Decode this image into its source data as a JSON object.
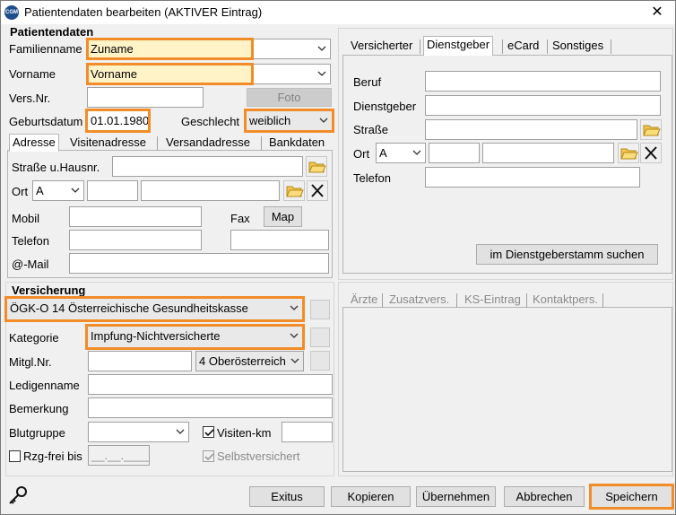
{
  "window": {
    "title": "Patientendaten bearbeiten (AKTIVER Eintrag)",
    "icon_text": "CGM"
  },
  "patient": {
    "section_title": "Patientendaten",
    "familienname_label": "Familienname",
    "familienname_value": "Zuname",
    "vorname_label": "Vorname",
    "vorname_value": "Vorname",
    "versnr_label": "Vers.Nr.",
    "versnr_value": "",
    "foto_label": "Foto",
    "geburtsdatum_label": "Geburtsdatum",
    "geburtsdatum_value": "01.01.1980",
    "geschlecht_label": "Geschlecht",
    "geschlecht_value": "weiblich"
  },
  "address_tabs": [
    "Adresse",
    "Visitenadresse",
    "Versandadresse",
    "Bankdaten"
  ],
  "address": {
    "strasse_label": "Straße u.Hausnr.",
    "ort_label": "Ort",
    "ort_country": "A",
    "mobil_label": "Mobil",
    "fax_label": "Fax",
    "map_label": "Map",
    "telefon_label": "Telefon",
    "mail_label": "@-Mail"
  },
  "right_tabs": [
    "Versicherter",
    "Dienstgeber",
    "eCard",
    "Sonstiges"
  ],
  "dienstgeber": {
    "beruf_label": "Beruf",
    "dienstgeber_label": "Dienstgeber",
    "strasse_label": "Straße",
    "ort_label": "Ort",
    "ort_country": "A",
    "telefon_label": "Telefon",
    "search_button": "im Dienstgeberstamm suchen"
  },
  "lower_tabs": [
    "Ärzte",
    "Zusatzvers.",
    "KS-Eintrag",
    "Kontaktpers."
  ],
  "versicherung": {
    "section_title": "Versicherung",
    "kasse_value": "ÖGK-O 14 Österreichische Gesundheitskasse",
    "kategorie_label": "Kategorie",
    "kategorie_value": "Impfung-Nichtversicherte",
    "mitglnr_label": "Mitgl.Nr.",
    "mitglnr_combo": "4 Oberösterreich",
    "ledigenname_label": "Ledigenname",
    "bemerkung_label": "Bemerkung",
    "blutgruppe_label": "Blutgruppe",
    "visiten_km_label": "Visiten-km",
    "rzg_label": "Rzg-frei bis",
    "rzg_value": "__.__.____",
    "selbstversichert_label": "Selbstversichert"
  },
  "footer": {
    "exitus": "Exitus",
    "kopieren": "Kopieren",
    "uebernehmen": "Übernehmen",
    "abbrechen": "Abbrechen",
    "speichern": "Speichern"
  },
  "colors": {
    "highlight": "#f28c28",
    "input_highlight": "#fff3c7"
  }
}
